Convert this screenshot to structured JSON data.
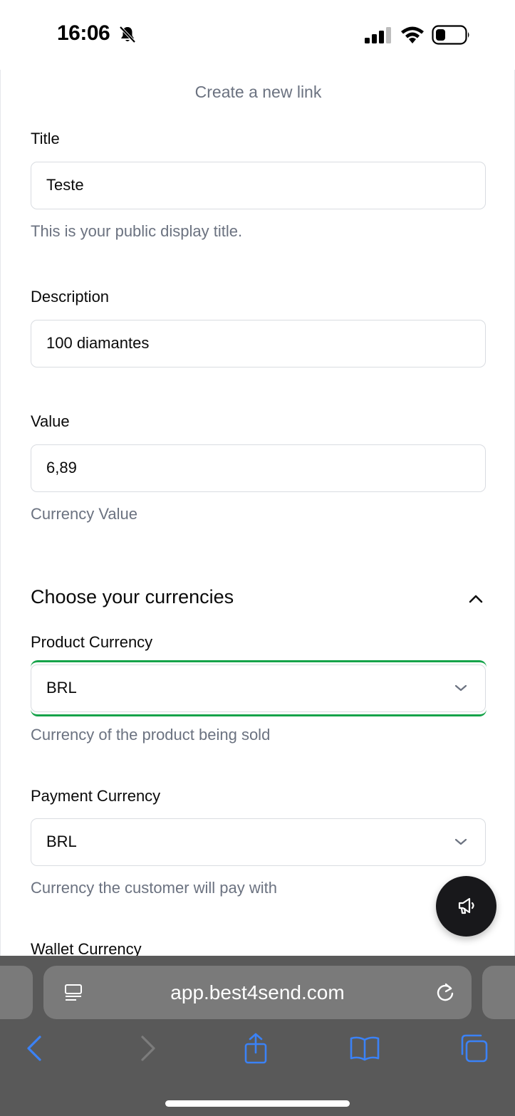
{
  "status_bar": {
    "time": "16:06"
  },
  "page": {
    "heading": "Create a new link",
    "title_field": {
      "label": "Title",
      "value": "Teste",
      "hint": "This is your public display title."
    },
    "description_field": {
      "label": "Description",
      "value": "100 diamantes"
    },
    "value_field": {
      "label": "Value",
      "value": "6,89",
      "hint": "Currency Value"
    },
    "currencies_section": {
      "title": "Choose your currencies",
      "product_currency": {
        "label": "Product Currency",
        "selected": "BRL",
        "hint": "Currency of the product being sold"
      },
      "payment_currency": {
        "label": "Payment Currency",
        "selected": "BRL",
        "hint": "Currency the customer will pay with"
      },
      "wallet_currency": {
        "label": "Wallet Currency"
      }
    }
  },
  "browser": {
    "url": "app.best4send.com"
  },
  "colors": {
    "focus": "#16a34a",
    "toolbar_icon": "#3b82f6",
    "browser_bg": "#595959"
  },
  "icons": [
    "bell-slash-icon",
    "signal-icon",
    "wifi-icon",
    "battery-icon",
    "chevron-up-icon",
    "chevron-down-icon",
    "megaphone-icon",
    "reader-icon",
    "reload-icon",
    "back-icon",
    "forward-icon",
    "share-icon",
    "bookmarks-icon",
    "tabs-icon"
  ]
}
